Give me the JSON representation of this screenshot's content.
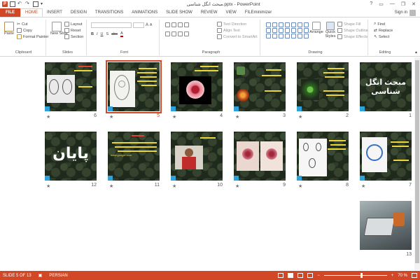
{
  "window": {
    "title": "مبحث انگل شناسی.pptx - PowerPoint",
    "controls": [
      "?",
      "▭",
      "—",
      "❐",
      "✕"
    ]
  },
  "tabs": [
    {
      "label": "FILE"
    },
    {
      "label": "HOME"
    },
    {
      "label": "INSERT"
    },
    {
      "label": "DESIGN"
    },
    {
      "label": "TRANSITIONS"
    },
    {
      "label": "ANIMATIONS"
    },
    {
      "label": "SLIDE SHOW"
    },
    {
      "label": "REVIEW"
    },
    {
      "label": "VIEW"
    },
    {
      "label": "FILEminimizer"
    }
  ],
  "account": {
    "signin": "Sign in"
  },
  "ribbon": {
    "clipboard": {
      "label": "Clipboard",
      "paste": "Paste",
      "cut": "Cut",
      "copy": "Copy",
      "format_painter": "Format Painter"
    },
    "slides": {
      "label": "Slides",
      "new_slide": "New Slide",
      "layout": "Layout",
      "reset": "Reset",
      "section": "Section"
    },
    "font": {
      "label": "Font"
    },
    "paragraph": {
      "label": "Paragraph",
      "text_direction": "Text Direction",
      "align_text": "Align Text",
      "convert": "Convert to SmartArt"
    },
    "drawing": {
      "label": "Drawing",
      "arrange": "Arrange",
      "quick_styles": "Quick Styles",
      "shape_fill": "Shape Fill",
      "shape_outline": "Shape Outline",
      "shape_effects": "Shape Effects"
    },
    "editing": {
      "label": "Editing",
      "find": "Find",
      "replace": "Replace",
      "select": "Select"
    }
  },
  "slides": [
    {
      "num": "1",
      "star": "",
      "text": "مبحث انگل شناسی"
    },
    {
      "num": "2",
      "star": "★",
      "text": ""
    },
    {
      "num": "3",
      "star": "★",
      "text": ""
    },
    {
      "num": "4",
      "star": "★",
      "text": ""
    },
    {
      "num": "5",
      "star": "★",
      "text": ""
    },
    {
      "num": "6",
      "star": "★",
      "text": ""
    },
    {
      "num": "7",
      "star": "★",
      "text": ""
    },
    {
      "num": "8",
      "star": "★",
      "text": ""
    },
    {
      "num": "9",
      "star": "★",
      "text": ""
    },
    {
      "num": "10",
      "star": "★",
      "text": ""
    },
    {
      "num": "11",
      "star": "★",
      "text": "www.google.com"
    },
    {
      "num": "12",
      "star": "★",
      "text": "پایان"
    },
    {
      "num": "13",
      "star": "",
      "text": ""
    }
  ],
  "status": {
    "slide": "SLIDE 5 OF 13",
    "language": "PERSIAN",
    "zoom": "70 %"
  },
  "colors": {
    "accent": "#d24726",
    "slide_bg": "#1f2a1c",
    "text_yellow": "#e8d63a",
    "text_red": "#e0452f"
  }
}
